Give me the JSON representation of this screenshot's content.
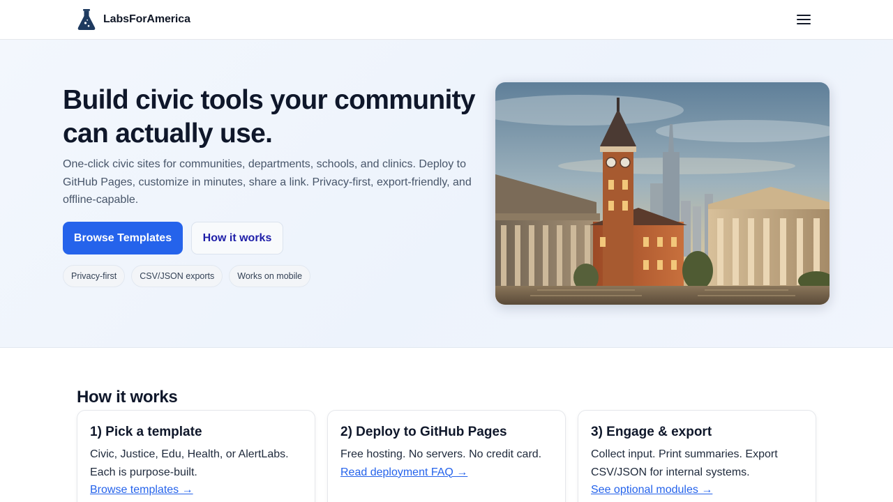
{
  "header": {
    "brand_name": "LabsForAmerica",
    "brand_icon": "flask-icon",
    "menu_icon": "hamburger-menu-icon"
  },
  "hero": {
    "title": "Build civic tools your community can actually use.",
    "subtitle": "One-click civic sites for communities, departments, schools, and clinics. Deploy to GitHub Pages, customize in minutes, share a link. Privacy-first, export-friendly, and offline-capable.",
    "primary_button": "Browse Templates",
    "secondary_button": "How it works",
    "chips": [
      "Privacy-first",
      "CSV/JSON exports",
      "Works on mobile"
    ],
    "image": "civic-buildings-clock-tower-illustration"
  },
  "how_it_works": {
    "title": "How it works",
    "cards": [
      {
        "title": "1) Pick a template",
        "body": "Civic, Justice, Edu, Health, or AlertLabs. Each is purpose-built.",
        "link": "Browse templates →"
      },
      {
        "title": "2) Deploy to GitHub Pages",
        "body": "Free hosting. No servers. No credit card.",
        "link": "Read deployment FAQ →"
      },
      {
        "title": "3) Engage & export",
        "body": "Collect input. Print summaries. Export CSV/JSON for internal systems.",
        "link": "See optional modules →"
      }
    ]
  },
  "colors": {
    "accent": "#2563eb",
    "secondary_text": "#1e1ea8",
    "brand_icon": "#1e3a5f",
    "heading": "#0f172a",
    "body_text": "#475569"
  }
}
